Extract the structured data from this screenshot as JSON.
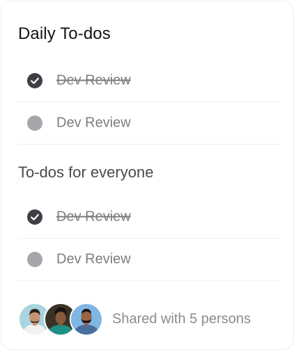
{
  "daily": {
    "title": "Daily To-dos",
    "items": [
      {
        "label": "Dev Review",
        "done": true
      },
      {
        "label": "Dev Review",
        "done": false
      }
    ]
  },
  "everyone": {
    "title": "To-dos for everyone",
    "items": [
      {
        "label": "Dev Review",
        "done": true
      },
      {
        "label": "Dev Review",
        "done": false
      }
    ]
  },
  "footer": {
    "shared_text": "Shared with 5 persons",
    "avatars": [
      "person-avatar-1",
      "person-avatar-2",
      "person-avatar-3"
    ]
  },
  "colors": {
    "checked": "#3f3f46",
    "unchecked": "#a6a6ab",
    "label": "#7d7d7d"
  },
  "icons": {
    "checked": "check-circle-icon",
    "unchecked": "empty-circle-icon"
  }
}
